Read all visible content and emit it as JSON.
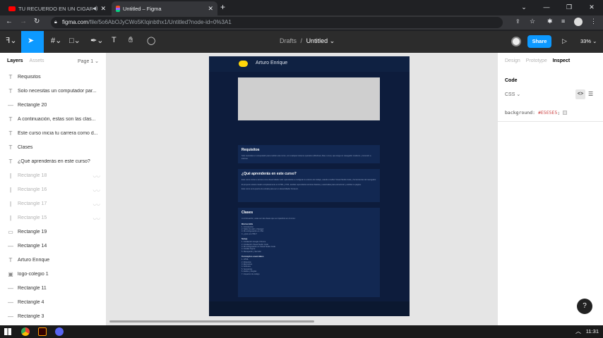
{
  "browser": {
    "tabs": [
      {
        "label": "TU RECUERDO EN UN CIGARRO",
        "active": false
      },
      {
        "label": "Untitled – Figma",
        "active": true
      }
    ],
    "new_tab": "+",
    "url_host": "figma.com",
    "url_path": "/file/5o6AbOJyCWo5KIqinbthx1/Untitled?node-id=0%3A1"
  },
  "figma": {
    "file": {
      "project": "Drafts",
      "separator": "/",
      "name": "Untitled"
    },
    "share_label": "Share",
    "zoom": "33%",
    "left_tabs": {
      "layers": "Layers",
      "assets": "Assets",
      "page": "Page 1"
    },
    "layers": [
      {
        "type": "text",
        "name": "Requisitos",
        "hidden": false
      },
      {
        "type": "text",
        "name": "Solo necesitas un computador par...",
        "hidden": false
      },
      {
        "type": "line",
        "name": "Rectangle 20",
        "hidden": false
      },
      {
        "type": "text",
        "name": "A continuación, estas son las clas...",
        "hidden": false
      },
      {
        "type": "text",
        "name": "Este curso inicia tu carrera como d...",
        "hidden": false
      },
      {
        "type": "text",
        "name": "Clases",
        "hidden": false
      },
      {
        "type": "text",
        "name": "¿Qué aprenderás en este curso?",
        "hidden": false
      },
      {
        "type": "vline",
        "name": "Rectangle 18",
        "hidden": true
      },
      {
        "type": "vline",
        "name": "Rectangle 16",
        "hidden": true
      },
      {
        "type": "vline",
        "name": "Rectangle 17",
        "hidden": true
      },
      {
        "type": "vline",
        "name": "Rectangle 15",
        "hidden": true
      },
      {
        "type": "rect",
        "name": "Rectangle 19",
        "hidden": false
      },
      {
        "type": "line",
        "name": "Rectangle 14",
        "hidden": false
      },
      {
        "type": "text",
        "name": "Arturo Enrique",
        "hidden": false
      },
      {
        "type": "image",
        "name": "logo-colegio 1",
        "hidden": false
      },
      {
        "type": "line",
        "name": "Rectangle 11",
        "hidden": false
      },
      {
        "type": "line",
        "name": "Rectangle 4",
        "hidden": false
      },
      {
        "type": "line",
        "name": "Rectangle 3",
        "hidden": false
      }
    ],
    "right_tabs": [
      "Design",
      "Prototype",
      "Inspect"
    ],
    "right_active": "Inspect",
    "code": {
      "heading": "Code",
      "language": "CSS",
      "property": "background:",
      "value": "#E5E5E5",
      "semicolon": ";"
    },
    "help": "?",
    "frame": {
      "header_name": "Arturo Enrique",
      "card1": {
        "title": "Requisitos",
        "body": "Solo necesitas un computador para realizar este curso, con cualquier sistema operativo (Windows, Mac, Linux), que tenga un navegador moderno y conexión a internet."
      },
      "card2": {
        "title": "¿Qué aprenderás en este curso?",
        "p1": "Este curso inicia tu carrera como desarrollador web: aprenderás a configurar tu entorno de trabajo, usando el editor Visual Studio Code y herramientas del navegador.",
        "p2": "El proyecto estará creado completamente en HTML y CSS, también aprenderás técnicas básicas y avanzadas para estructurar y estilizar tu página.",
        "p3": "Este curso es la puerta de entrada para ser un desarrollador frontend."
      },
      "card3": {
        "title": "Clases",
        "intro": "A continuación, estas son las clases que se impartirán en el curso:",
        "s1_title": "Bienvenida",
        "s1_items": [
          "1. Introducción",
          "2. Saber de web y Navegar",
          "3. Mi configuración en VSC",
          "4. ¿Qué es HTML?"
        ],
        "s2_title": "Setup",
        "s2_items": [
          "1. Instalación Google Chrome",
          "2. Instalación Visual Studio Code",
          "3. Mi configuración en Visual Studio Code",
          "4. Instalar Figma",
          "5. Manejando y Servidor"
        ],
        "s3_title": "Conceptos esenciales",
        "s3_items": [
          "1. HTML",
          "2. Etiquetas",
          "3. Elementos",
          "4. Atributos",
          "5. Semántica",
          "6. Estilos y Reglas",
          "7. Inspector de código"
        ]
      }
    }
  },
  "taskbar": {
    "time": "11:31"
  },
  "colors": {
    "accent": "#0d99ff",
    "frame_bg": "#0d1c3c",
    "card_bg": "#122852",
    "canvas_bg": "#E5E5E5",
    "logo": "#ffd60a"
  }
}
